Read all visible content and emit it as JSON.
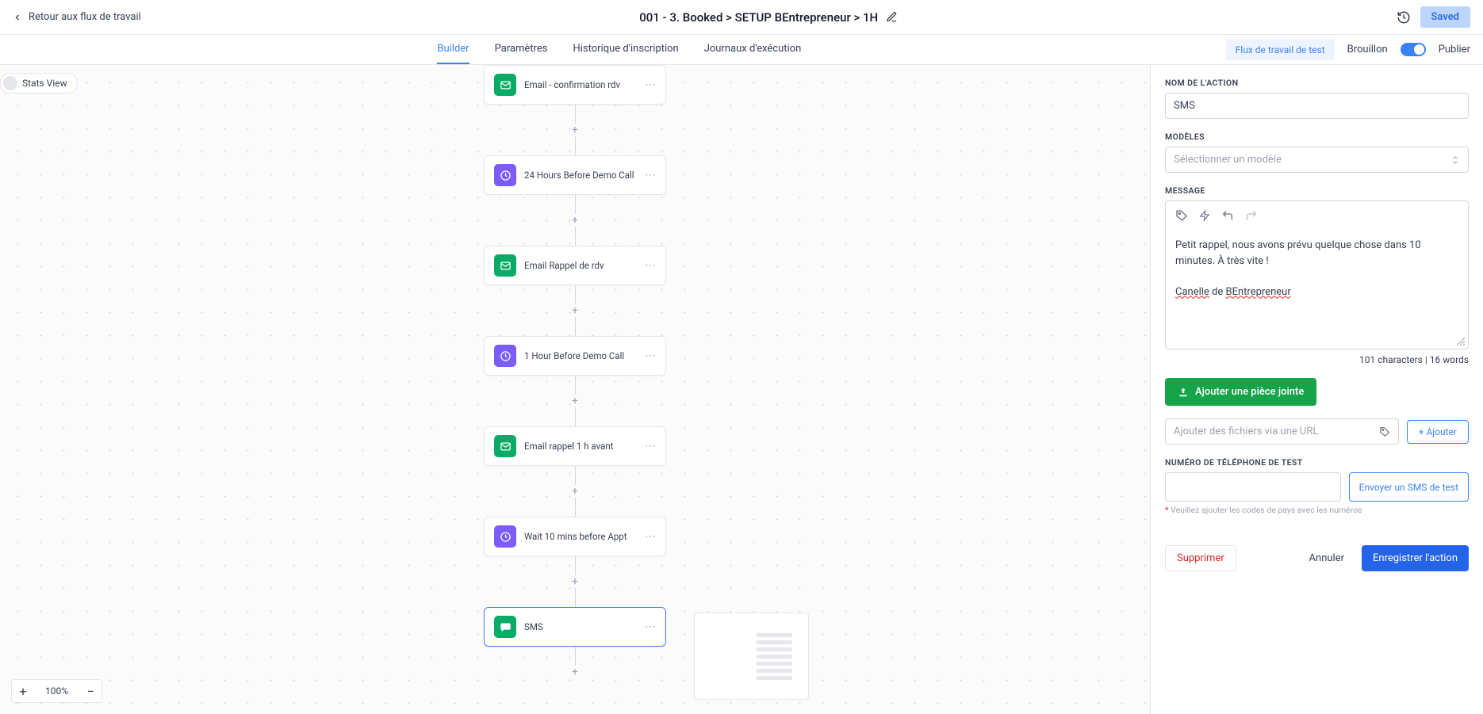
{
  "header": {
    "back": "Retour aux flux de travail",
    "title": "001 - 3. Booked > SETUP BEntrepreneur > 1H",
    "saved": "Saved"
  },
  "tabs": {
    "builder": "Builder",
    "params": "Paramètres",
    "history": "Historique d'inscription",
    "logs": "Journaux d'exécution",
    "testflow": "Flux de travail de test",
    "draft": "Brouillon",
    "publish": "Publier"
  },
  "stats": "Stats View",
  "nodes": {
    "n0": "Email - confirmation rdv",
    "n1": "24 Hours Before Demo Call",
    "n2": "Email Rappel de rdv",
    "n3": "1 Hour Before Demo Call",
    "n4": "Email rappel 1 h avant",
    "n5": "Wait 10 mins before Appt",
    "n6": "SMS"
  },
  "zoom": "100%",
  "panel": {
    "action_name_label": "NOM DE L'ACTION",
    "action_name_value": "SMS",
    "models_label": "MODÈLES",
    "models_placeholder": "Sélectionner un modèle",
    "message_label": "MESSAGE",
    "msg_l1": "Petit rappel, nous avons prévu quelque chose dans 10 minutes. À très vite !",
    "msg_l2a": "Canelle",
    "msg_l2b": " de ",
    "msg_l2c": "BEntrepreneur",
    "char_count": "101 characters | 16 words",
    "attach": "Ajouter une pièce jointe",
    "url_placeholder": "Ajouter des fichiers via une URL",
    "add": "+ Ajouter",
    "phone_label": "NUMÉRO DE TÉLÉPHONE DE TEST",
    "send_test": "Envoyer un SMS de test",
    "helper": "Veuillez ajouter les codes de pays avec les numéros",
    "delete": "Supprimer",
    "cancel": "Annuler",
    "save": "Enregistrer l'action"
  }
}
